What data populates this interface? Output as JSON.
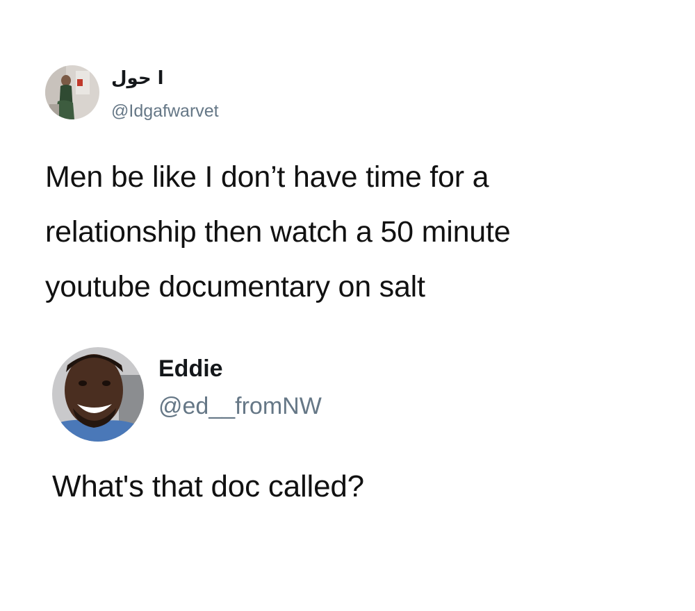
{
  "tweets": [
    {
      "author": {
        "display_name": "ا حول",
        "handle": "@Idgafwarvet",
        "avatar_icon": "profile-photo"
      },
      "text_lines": [
        "Men be like I don’t have time for a",
        "relationship then watch a 50 minute",
        "youtube documentary on salt"
      ]
    },
    {
      "author": {
        "display_name": "Eddie",
        "handle": "@ed__fromNW",
        "avatar_icon": "profile-photo"
      },
      "text_lines": [
        "What's that doc called?"
      ]
    }
  ],
  "colors": {
    "background": "#ffffff",
    "text": "#111111",
    "handle": "#657786"
  }
}
